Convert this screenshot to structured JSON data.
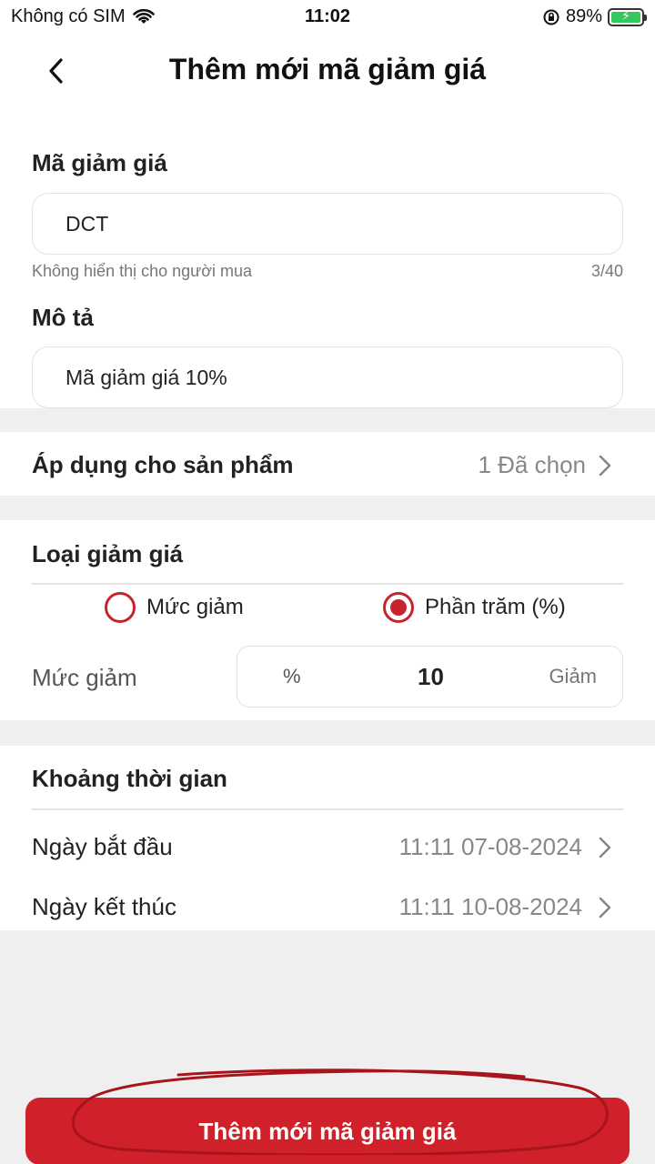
{
  "status_bar": {
    "carrier": "Không có SIM",
    "time": "11:02",
    "battery_percent": "89%",
    "icons": [
      "wifi-icon",
      "orientation-lock-icon",
      "battery-charging-icon"
    ]
  },
  "header": {
    "title": "Thêm mới mã giảm giá",
    "back_icon": "chevron-left-icon"
  },
  "voucher_code": {
    "label": "Mã giảm giá",
    "value": "DCT",
    "hint": "Không hiển thị cho người mua",
    "counter": "3/40"
  },
  "description": {
    "label": "Mô tả",
    "value": "Mã giảm giá 10%"
  },
  "apply_products": {
    "label": "Áp dụng cho sản phẩm",
    "value": "1 Đã chọn"
  },
  "discount_type": {
    "label": "Loại giảm giá",
    "options": [
      {
        "label": "Mức giảm",
        "selected": false
      },
      {
        "label": "Phần trăm (%)",
        "selected": true
      }
    ],
    "amount_label": "Mức giảm",
    "unit": "%",
    "amount_value": "10",
    "suffix": "Giảm"
  },
  "time_period": {
    "label": "Khoảng thời gian",
    "start_label": "Ngày bắt đầu",
    "start_value": "11:11 07-08-2024",
    "end_label": "Ngày kết thúc",
    "end_value": "11:11 10-08-2024"
  },
  "submit": {
    "label": "Thêm mới mã giảm giá"
  },
  "colors": {
    "accent": "#d0202a",
    "annotation": "#a8141c",
    "background": "#efefef"
  }
}
